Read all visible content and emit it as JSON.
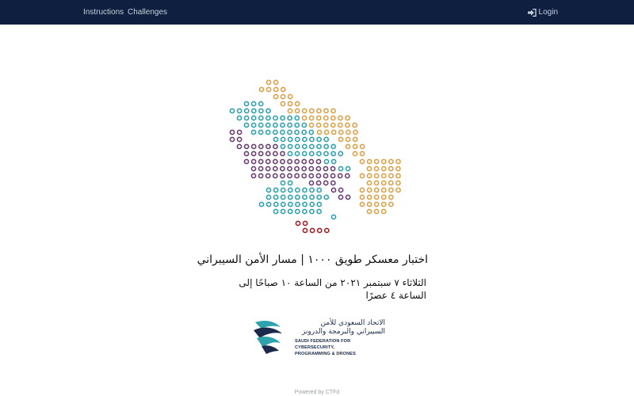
{
  "navbar": {
    "links": [
      {
        "label": "Instructions"
      },
      {
        "label": "Challenges"
      }
    ],
    "login_label": "Login",
    "login_icon": "sign-in-icon",
    "background": "#0e1f3f"
  },
  "main": {
    "logo_name": "tuwaiq-camp-map-logo",
    "logo_colors": {
      "orange": "#dba14a",
      "teal": "#2ea2ad",
      "purple": "#6b3f73",
      "red": "#a32128"
    },
    "title": "اختبار معسكر طويق ١٠٠٠ | مسار الأمن السيبراني",
    "subtitle": "الثلاثاء ٧ سبتمبر ٢٠٢١ من الساعة ١٠ صباحًا إلى الساعة ٤ عصرًا",
    "partner": {
      "arabic_name": "الاتحاد السعودي للأمن السيبراني والبرمجة والدرونز",
      "english_line1": "SAUDI FEDERATION FOR CYBERSECURITY,",
      "english_line2": "PROGRAMMING & DRONES"
    }
  },
  "footer": {
    "text": "Powered by CTFd"
  }
}
